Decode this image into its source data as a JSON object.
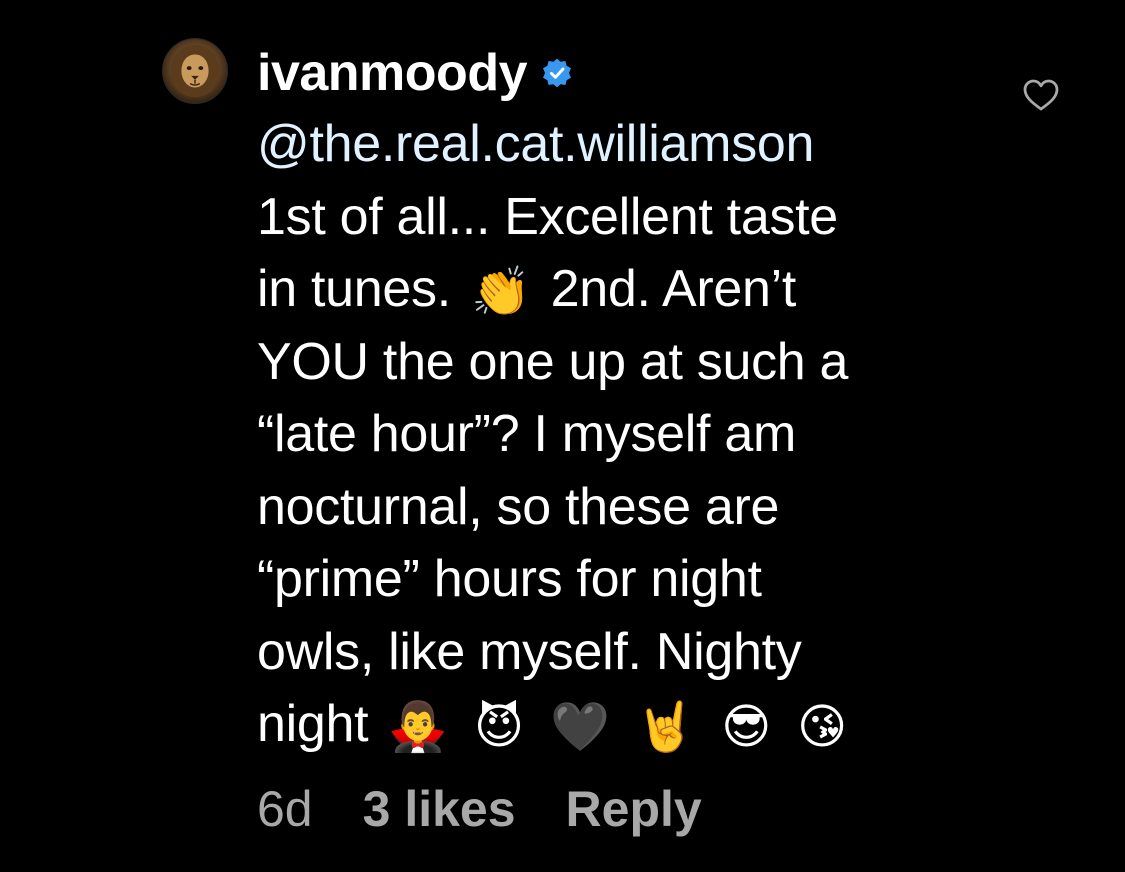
{
  "comment": {
    "username": "ivanmoody",
    "verified": true,
    "verified_color": "#3897f0",
    "mention": "@the.real.cat.williamson",
    "lines": [
      "1st of all... Excellent taste",
      "in tunes.",
      "2nd. Aren’t",
      "YOU the one up at such a",
      "“late hour”? I myself am",
      "nocturnal, so these are",
      "“prime” hours for night",
      "owls, like myself. Nighty",
      "night"
    ],
    "emojis": {
      "clap": "👏",
      "vampire": "🧛‍♂️",
      "devil": "😈",
      "black_heart": "🖤",
      "rock_on": "🤘",
      "sunglasses": "😎",
      "kiss": "😘"
    },
    "meta": {
      "time": "6d",
      "likes": "3 likes",
      "reply": "Reply"
    },
    "icons": {
      "avatar": "lion-avatar",
      "verified": "verified-badge-icon",
      "like": "heart-outline-icon"
    }
  }
}
